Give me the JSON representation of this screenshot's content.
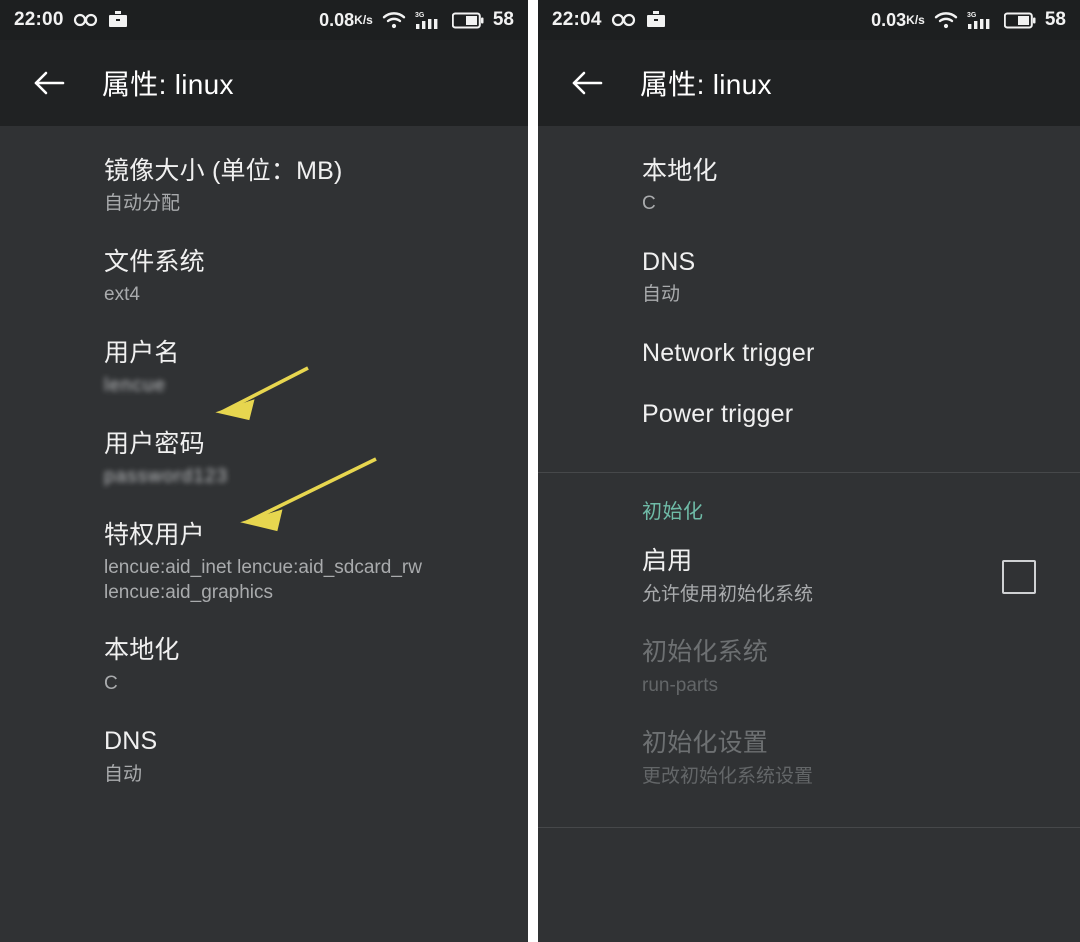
{
  "left_panel": {
    "statusbar": {
      "time": "22:00",
      "net_speed": "0.08",
      "net_speed_unit": "K/s",
      "battery_percent": "58",
      "icons": [
        "infinity-icon",
        "briefcase-icon",
        "wifi-icon",
        "signal-3g-icon",
        "battery-icon"
      ]
    },
    "toolbar": {
      "back_icon": "arrow-back-icon",
      "title": "属性: linux"
    },
    "items": [
      {
        "title": "镜像大小 (单位：MB)",
        "sub": "自动分配",
        "state": "enabled",
        "redacted": false
      },
      {
        "title": "文件系统",
        "sub": "ext4",
        "state": "enabled",
        "redacted": false
      },
      {
        "title": "用户名",
        "sub": "lencue",
        "state": "enabled",
        "redacted": true
      },
      {
        "title": "用户密码",
        "sub": "password123",
        "state": "enabled",
        "redacted": true
      },
      {
        "title": "特权用户",
        "sub": "lencue:aid_inet lencue:aid_sdcard_rw\nlencue:aid_graphics",
        "state": "enabled",
        "redacted": "partial"
      },
      {
        "title": "本地化",
        "sub": "C",
        "state": "enabled",
        "redacted": false
      },
      {
        "title": "DNS",
        "sub": "自动",
        "state": "enabled",
        "redacted": false
      }
    ],
    "annotations": [
      {
        "name": "arrow-to-username",
        "color": "#e7d64f"
      },
      {
        "name": "arrow-to-password",
        "color": "#e7d64f"
      }
    ]
  },
  "right_panel": {
    "statusbar": {
      "time": "22:04",
      "net_speed": "0.03",
      "net_speed_unit": "K/s",
      "battery_percent": "58",
      "icons": [
        "infinity-icon",
        "briefcase-icon",
        "wifi-icon",
        "signal-3g-icon",
        "battery-icon"
      ]
    },
    "toolbar": {
      "back_icon": "arrow-back-icon",
      "title": "属性: linux"
    },
    "items": [
      {
        "title": "本地化",
        "sub": "C",
        "state": "enabled"
      },
      {
        "title": "DNS",
        "sub": "自动",
        "state": "enabled"
      },
      {
        "title": "Network trigger",
        "sub": "",
        "state": "enabled"
      },
      {
        "title": "Power trigger",
        "sub": "",
        "state": "enabled"
      }
    ],
    "section": {
      "header": "初始化",
      "enable_row": {
        "title": "启用",
        "sub": "允许使用初始化系统",
        "checkbox_checked": false
      },
      "items": [
        {
          "title": "初始化系统",
          "sub": "run-parts",
          "state": "disabled"
        },
        {
          "title": "初始化设置",
          "sub": "更改初始化系统设置",
          "state": "disabled"
        }
      ]
    }
  },
  "colors": {
    "background": "#303234",
    "statusbar_bg": "#1d1f20",
    "toolbar_bg": "#202223",
    "accent_teal": "#6fbba7",
    "annotation_yellow": "#e7d64f",
    "primary_text": "#f0f0f0",
    "secondary_text": "#a9abad",
    "disabled_text": "#6d7072"
  }
}
